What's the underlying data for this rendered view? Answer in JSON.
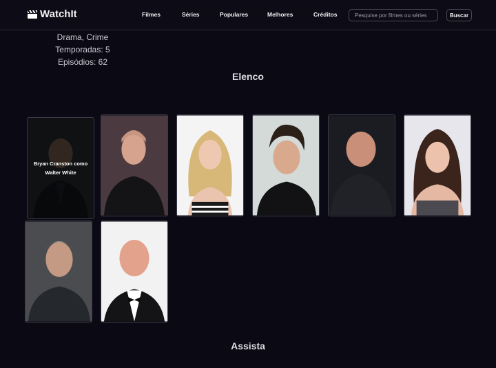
{
  "navbar": {
    "brand": "WatchIt",
    "links": [
      "Filmes",
      "Séries",
      "Populares",
      "Melhores",
      "Créditos"
    ],
    "search_placeholder": "Pesquise por filmes ou séries",
    "search_button": "Buscar"
  },
  "details": {
    "genres": "Drama, Crime",
    "seasons": "Temporadas: 5",
    "episodes": "Episódios: 62"
  },
  "cast_section_title": "Elenco",
  "cast": [
    {
      "caption": "Bryan Cranston como Walter White"
    }
  ],
  "watch_section_title": "Assista"
}
